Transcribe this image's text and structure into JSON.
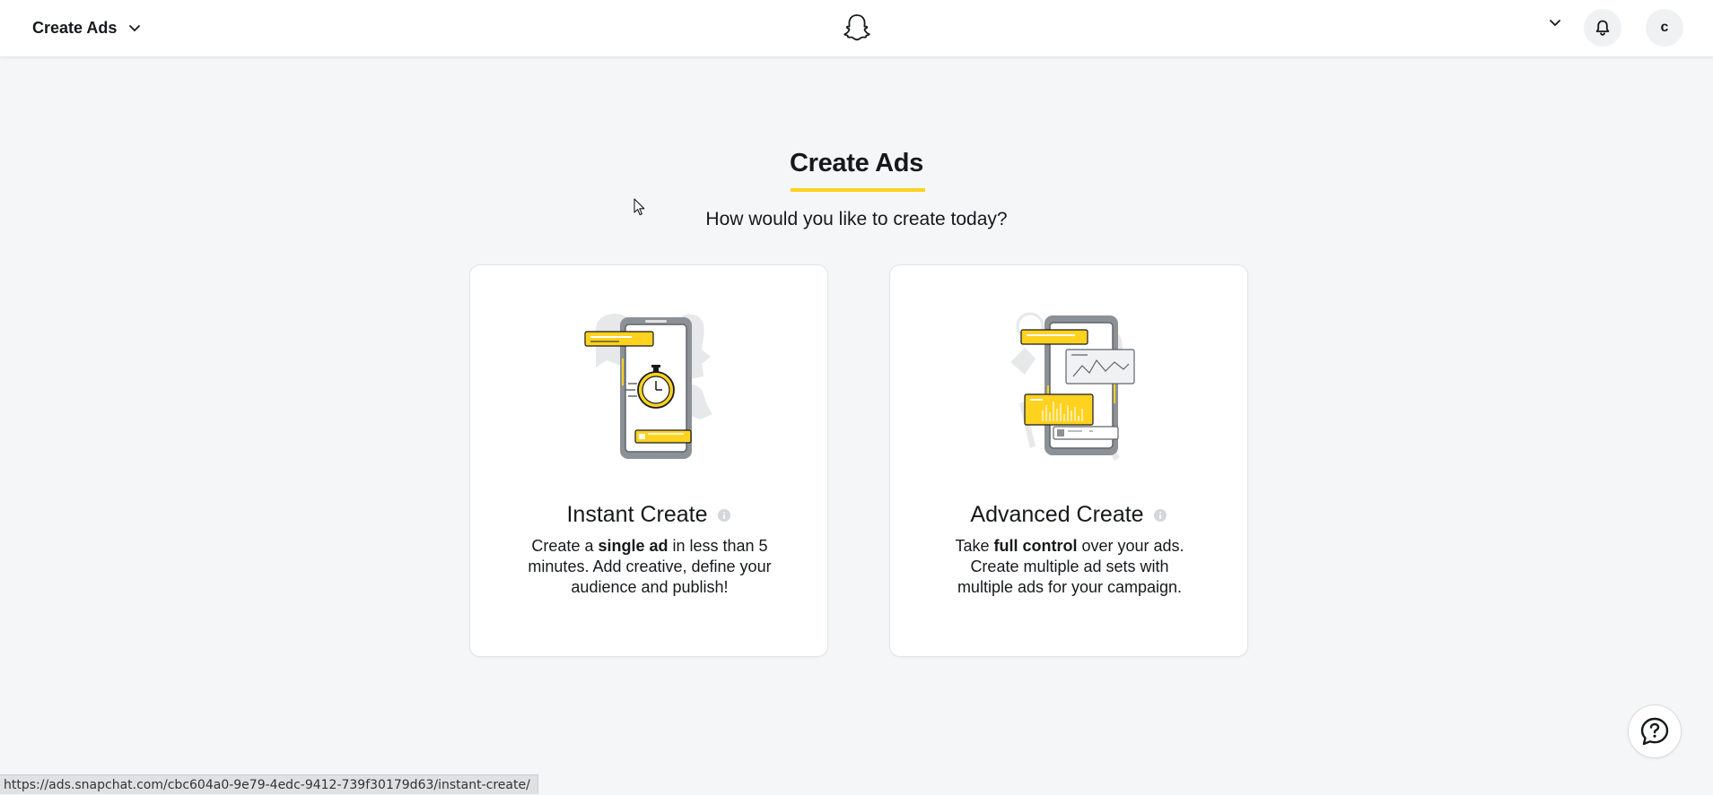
{
  "header": {
    "menu_label": "Create Ads",
    "avatar_initial": "c"
  },
  "main": {
    "title": "Create Ads",
    "subtitle": "How would you like to create today?",
    "options": [
      {
        "title": "Instant Create",
        "desc_pre": "Create a ",
        "desc_bold": "single ad",
        "desc_post": " in less than 5 minutes. Add creative, define your audience and publish!"
      },
      {
        "title": "Advanced Create",
        "desc_pre": "Take ",
        "desc_bold": "full control",
        "desc_post": " over your ads. Create multiple ad sets with multiple ads for your campaign."
      }
    ]
  },
  "status_bar": {
    "url": "https://ads.snapchat.com/cbc604a0-9e79-4edc-9412-739f30179d63/instant-create/"
  },
  "colors": {
    "accent_yellow": "#ffd21f",
    "background": "#f5f6f7",
    "text": "#16191c"
  },
  "icons": [
    "chevron-down-icon",
    "snapchat-ghost-icon",
    "bell-icon",
    "info-icon",
    "help-chat-icon"
  ]
}
